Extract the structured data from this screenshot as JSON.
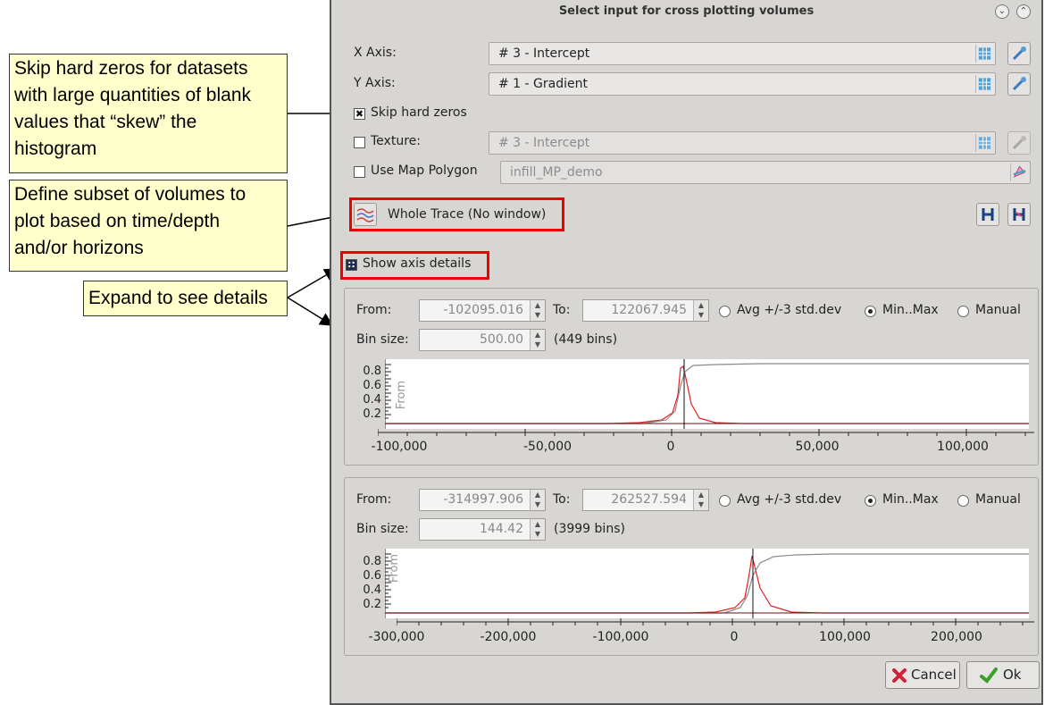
{
  "callouts": {
    "skip_zeros": [
      "Skip hard zeros for datasets",
      "with large quantities of blank",
      "values that “skew” the",
      "histogram"
    ],
    "subset": [
      "Define subset of volumes to",
      "plot based on time/depth",
      "and/or horizons"
    ],
    "expand": "Expand to see details"
  },
  "dialog": {
    "title": "Select input for cross plotting volumes",
    "x_axis": {
      "label": "X Axis:",
      "value": "# 3 - Intercept"
    },
    "y_axis": {
      "label": "Y Axis:",
      "value": "# 1 - Gradient"
    },
    "skip_hard_zeros": {
      "label": "Skip hard zeros",
      "checked": true
    },
    "texture": {
      "label": "Texture:",
      "value": "# 3 - Intercept",
      "checked": false
    },
    "map_polygon": {
      "label": "Use Map Polygon",
      "value": "infill_MP_demo",
      "checked": false
    },
    "trace_window": "Whole Trace (No window)",
    "show_axis_details": {
      "label": "Show axis details",
      "checked": true
    },
    "panel1": {
      "from_label": "From:",
      "from": "-102095.016",
      "to_label": "To:",
      "to": "122067.945",
      "opt_avg": "Avg +/-3 std.dev",
      "opt_minmax": "Min..Max",
      "opt_manual": "Manual",
      "selected": "Min..Max",
      "bin_label": "Bin size:",
      "bin": "500.00",
      "bins": "(449 bins)",
      "plot_label": "From",
      "y_ticks": [
        "0.8",
        "0.6",
        "0.4",
        "0.2"
      ],
      "x_ticks": [
        "-100,000",
        "-50,000",
        "0",
        "50,000",
        "100,000"
      ]
    },
    "panel2": {
      "from_label": "From:",
      "from": "-314997.906",
      "to_label": "To:",
      "to": "262527.594",
      "opt_avg": "Avg +/-3 std.dev",
      "opt_minmax": "Min..Max",
      "opt_manual": "Manual",
      "selected": "Min..Max",
      "bin_label": "Bin size:",
      "bin": "144.42",
      "bins": "(3999 bins)",
      "plot_label": "From",
      "y_ticks": [
        "0.8",
        "0.6",
        "0.4",
        "0.2"
      ],
      "x_ticks": [
        "-300,000",
        "-200,000",
        "-100,000",
        "0",
        "100,000",
        "200,000"
      ]
    },
    "cancel": "Cancel",
    "ok": "Ok"
  },
  "colors": {
    "histogram": "#e02020",
    "cumulative": "#8a8a8a",
    "highlight": "#e00000",
    "callout_bg": "#ffffcc"
  },
  "icons": [
    "volume-grid-icon",
    "pick-icon",
    "trace-window-icon",
    "horizon-icon",
    "polygon-icon",
    "cancel-x-icon",
    "ok-check-icon"
  ]
}
